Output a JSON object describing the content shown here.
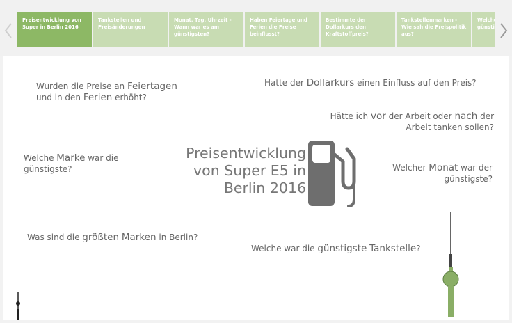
{
  "tabs": [
    {
      "label": "Preisentwicklung von Super in Berlin 2016",
      "active": true
    },
    {
      "label": "Tankstellen und Preisänderungen",
      "active": false
    },
    {
      "label": "Monat, Tag, Uhrzeit - Wann war es am günstigsten?",
      "active": false
    },
    {
      "label": "Haben Feiertage und Ferien die Preise beinflusst?",
      "active": false
    },
    {
      "label": "Bestimmte der Dollarkurs den Kraftstoffpreis?",
      "active": false
    },
    {
      "label": "Tankstellenmarken - Wie sah die Preispolitik aus?",
      "active": false
    },
    {
      "label": "Welche war die günstigste?",
      "active": false
    }
  ],
  "nav": {
    "prev_icon": "chevron-left-icon",
    "next_icon": "chevron-right-icon"
  },
  "main": {
    "title_line1": "Preisentwicklung",
    "title_line2": "von Super E5 in",
    "title_line3": "Berlin 2016",
    "questions": {
      "holidays": {
        "pre": "Wurden die Preise an ",
        "kw1": "Feiertagen",
        "mid": "und in den ",
        "kw2": "Ferien",
        "post": " erhöht?"
      },
      "dollar": {
        "pre": "Hatte der ",
        "kw": "Dollarkurs",
        "post": " einen Einfluss auf den Preis?"
      },
      "worktime": {
        "pre": "Hätte ich ",
        "kw1": "vor",
        "mid1": " der Arbeit oder ",
        "kw2": "nach",
        "mid2": " der",
        "line2": "Arbeit tanken sollen?"
      },
      "brand": {
        "pre": "Welche ",
        "kw": "Marke",
        "post": " war die",
        "line2": "günstigste?"
      },
      "month": {
        "pre": "Welcher ",
        "kw": "Monat",
        "post": " war der",
        "line2": "günstigste?"
      },
      "biggest": {
        "pre": "Was sind die ",
        "kw1": "größten",
        "mid": " ",
        "kw2": "Marken",
        "post": " in Berlin?"
      },
      "station": {
        "pre": "Welche war die ",
        "kw": "günstigste",
        "mid": " ",
        "kw2": "Tankstelle",
        "post": "?"
      }
    }
  },
  "colors": {
    "accent": "#8db865",
    "tab_inactive": "#c8dcb3",
    "pump": "#6e6e6e",
    "tower": "#8aae66"
  }
}
